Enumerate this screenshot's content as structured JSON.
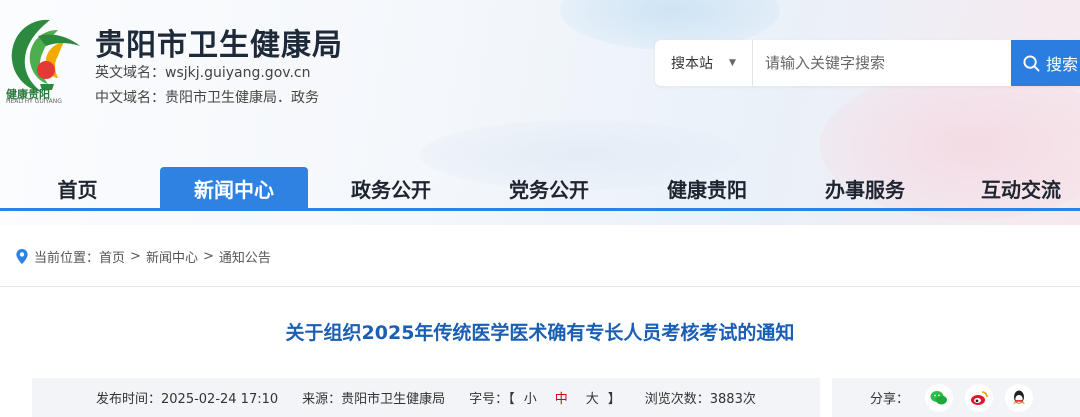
{
  "header": {
    "logo_text": "健康贵阳",
    "logo_subtext": "HEALTHY GUIYANG",
    "title": "贵阳市卫生健康局",
    "en_domain": "英文域名：wsjkj.guiyang.gov.cn",
    "cn_domain": "中文域名：贵阳市卫生健康局．政务"
  },
  "search": {
    "scope": "搜本站",
    "placeholder": "请输入关键字搜索",
    "button_label": "搜索"
  },
  "nav": {
    "items": [
      {
        "label": "首页"
      },
      {
        "label": "新闻中心",
        "active": true
      },
      {
        "label": "政务公开"
      },
      {
        "label": "党务公开"
      },
      {
        "label": "健康贵阳"
      },
      {
        "label": "办事服务"
      },
      {
        "label": "互动交流"
      }
    ]
  },
  "breadcrumb": {
    "prefix": "当前位置：",
    "items": [
      "首页",
      "新闻中心",
      "通知公告"
    ],
    "separator": ">"
  },
  "article": {
    "title": "关于组织2025年传统医学医术确有专长人员考核考试的通知",
    "publish_time": "发布时间：2025-02-24 17:10",
    "source": "来源：贵阳市卫生健康局",
    "font_size_label": "字号：",
    "font_sizes": [
      "小",
      "中",
      "大"
    ],
    "views": "浏览次数：3883次"
  },
  "share": {
    "label": "分享：",
    "icons": [
      "wechat-icon",
      "weibo-icon",
      "qq-icon"
    ]
  },
  "colors": {
    "accent": "#2d82e2",
    "title_blue": "#1a5fb4",
    "font_size_active": "#d0021b"
  }
}
